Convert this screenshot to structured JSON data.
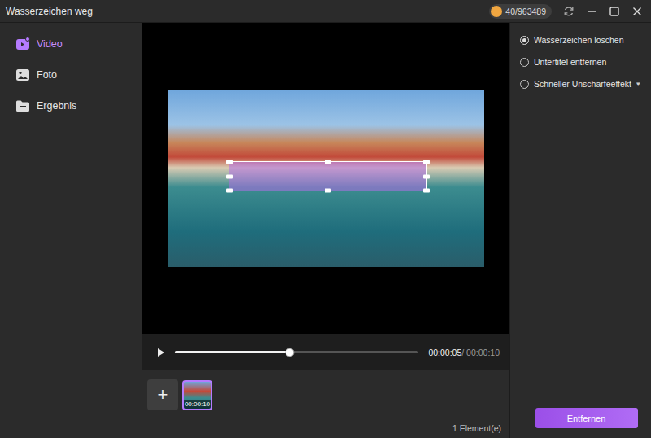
{
  "window": {
    "title": "Wasserzeichen weg",
    "credits": "40/963489"
  },
  "sidebar": {
    "items": [
      {
        "label": "Video",
        "selected": true
      },
      {
        "label": "Foto",
        "selected": false
      },
      {
        "label": "Ergebnis",
        "selected": false
      }
    ]
  },
  "player": {
    "level": 0.47,
    "current": "00:00:05",
    "separator": "/",
    "total": "00:00:10"
  },
  "timeline": {
    "add": "+",
    "clips": [
      {
        "duration": "00:00:10",
        "selected": true
      }
    ],
    "count": "1 Element(e)"
  },
  "options": [
    {
      "label": "Wasserzeichen löschen",
      "selected": true,
      "kind": "radio"
    },
    {
      "label": "Untertitel entfernen",
      "selected": false,
      "kind": "radio"
    },
    {
      "label": "Schneller Unschärfeeffekt",
      "selected": false,
      "kind": "dropdown",
      "caret": "▾"
    }
  ],
  "buttons": [
    "Entfernen"
  ]
}
